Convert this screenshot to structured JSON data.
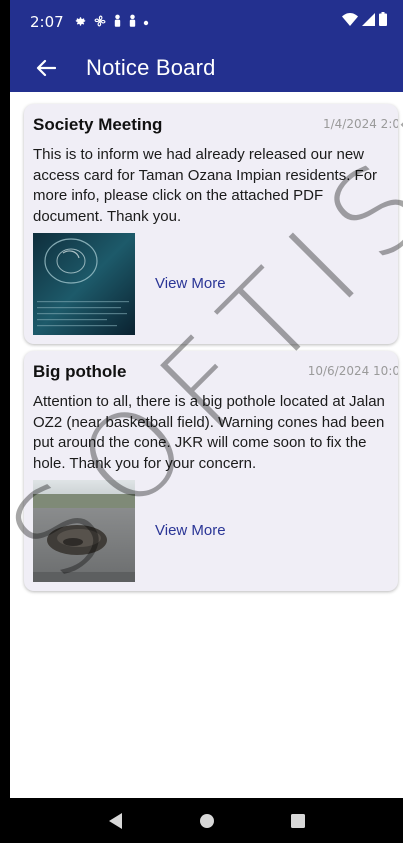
{
  "status_bar": {
    "time": "2:07",
    "icons": [
      "gear-icon",
      "fan-icon",
      "person-icon",
      "person-icon",
      "dot-icon"
    ],
    "right_icons": [
      "wifi-icon",
      "signal-icon",
      "battery-icon"
    ]
  },
  "app_bar": {
    "title": "Notice Board",
    "back_icon": "arrow-left-icon"
  },
  "notices": [
    {
      "title": "Society Meeting",
      "date": "1/4/2024 2:0",
      "body": "This is to inform we had already released our new access card for Taman Ozana Impian residents. For more info, please click on the attached PDF document. Thank you.",
      "view_more": "View More"
    },
    {
      "title": "Big pothole",
      "date": "10/6/2024 10:0",
      "body": "Attention to all, there is a big pothole located at Jalan OZ2 (near basketball field). Warning cones had been put around the cone. JKR will come soon to fix the hole. Thank you for your concern.",
      "view_more": "View More"
    }
  ],
  "watermark": "SOFTISM",
  "colors": {
    "primary": "#23308f",
    "card_bg": "#f0eef6",
    "link": "#2a3596",
    "date": "#9a9a9a"
  }
}
